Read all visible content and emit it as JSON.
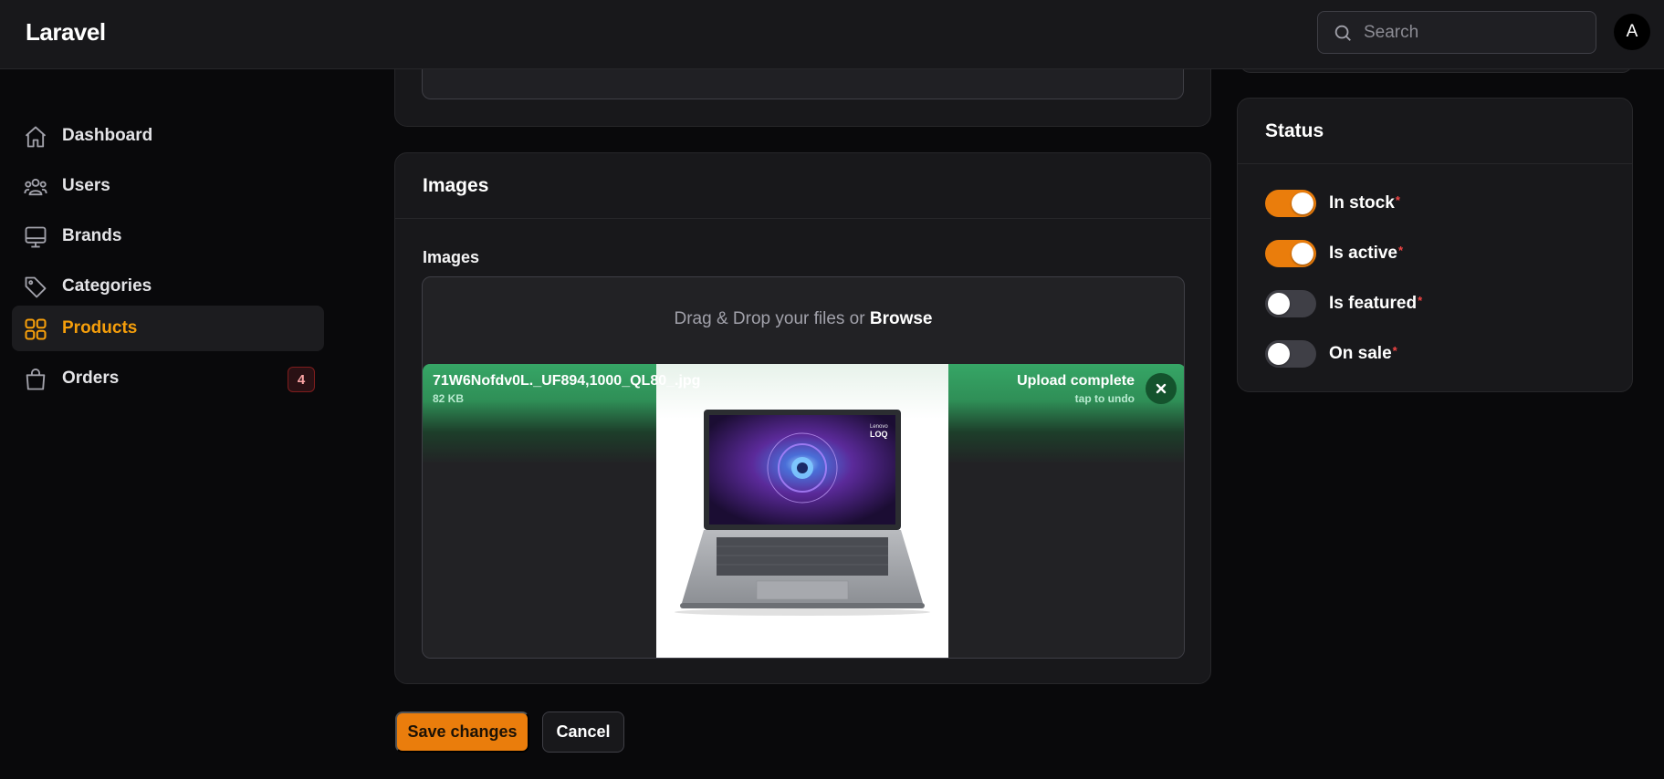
{
  "app": {
    "brand": "Laravel"
  },
  "header": {
    "search_placeholder": "Search",
    "avatar_initial": "A"
  },
  "sidebar": {
    "items": [
      {
        "label": "Dashboard",
        "icon": "home-icon",
        "active": false
      },
      {
        "label": "Users",
        "icon": "users-icon",
        "active": false
      },
      {
        "label": "Brands",
        "icon": "monitor-icon",
        "active": false
      },
      {
        "label": "Categories",
        "icon": "tag-icon",
        "active": false
      },
      {
        "label": "Products",
        "icon": "squares-icon",
        "active": true
      },
      {
        "label": "Orders",
        "icon": "shopping-bag-icon",
        "active": false,
        "badge": "4"
      }
    ]
  },
  "images_section": {
    "title": "Images",
    "field_label": "Images",
    "dropzone_text": "Drag & Drop your files or",
    "dropzone_browse": "Browse",
    "file": {
      "name": "71W6Nofdv0L._UF894,1000_QL80_.jpg",
      "size": "82 KB",
      "status": "Upload complete",
      "status_hint": "tap to undo",
      "preview_logo_line1": "Lenovo",
      "preview_logo_line2": "LOQ"
    }
  },
  "actions": {
    "save_label": "Save changes",
    "cancel_label": "Cancel"
  },
  "status_section": {
    "title": "Status",
    "toggles": [
      {
        "label": "In stock",
        "required": "*",
        "on": true
      },
      {
        "label": "Is active",
        "required": "*",
        "on": true
      },
      {
        "label": "Is featured",
        "required": "*",
        "on": false
      },
      {
        "label": "On sale",
        "required": "*",
        "on": false
      }
    ]
  },
  "colors": {
    "accent": "#ea7d0c",
    "active_nav": "#f59e0b",
    "upload_success": "#36a666",
    "background": "#09090b",
    "card": "#18181b"
  }
}
